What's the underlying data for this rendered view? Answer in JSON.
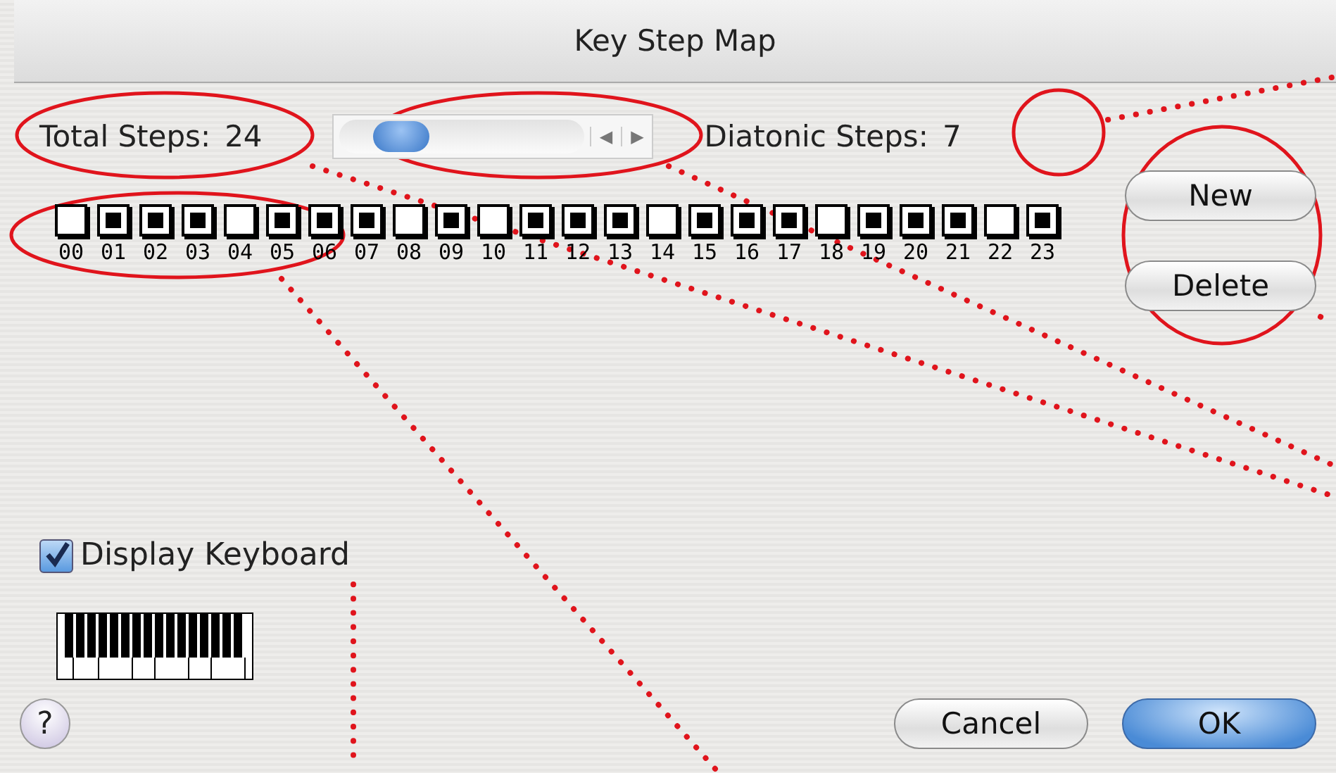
{
  "window": {
    "title": "Key Step Map"
  },
  "total_steps": {
    "label": "Total Steps:",
    "value": "24"
  },
  "diatonic_steps": {
    "label": "Diatonic Steps:",
    "value": "7"
  },
  "steps": [
    {
      "label": "00",
      "checked": false
    },
    {
      "label": "01",
      "checked": true
    },
    {
      "label": "02",
      "checked": true
    },
    {
      "label": "03",
      "checked": true
    },
    {
      "label": "04",
      "checked": false
    },
    {
      "label": "05",
      "checked": true
    },
    {
      "label": "06",
      "checked": true
    },
    {
      "label": "07",
      "checked": true
    },
    {
      "label": "08",
      "checked": false
    },
    {
      "label": "09",
      "checked": true
    },
    {
      "label": "10",
      "checked": false
    },
    {
      "label": "11",
      "checked": true
    },
    {
      "label": "12",
      "checked": true
    },
    {
      "label": "13",
      "checked": true
    },
    {
      "label": "14",
      "checked": false
    },
    {
      "label": "15",
      "checked": true
    },
    {
      "label": "16",
      "checked": true
    },
    {
      "label": "17",
      "checked": true
    },
    {
      "label": "18",
      "checked": false
    },
    {
      "label": "19",
      "checked": true
    },
    {
      "label": "20",
      "checked": true
    },
    {
      "label": "21",
      "checked": true
    },
    {
      "label": "22",
      "checked": false
    },
    {
      "label": "23",
      "checked": true
    }
  ],
  "side_buttons": [
    "New",
    "Delete"
  ],
  "scroll_arrows": [
    "◀",
    "▶"
  ],
  "display_keyboard": {
    "label": "Display Keyboard",
    "checked": true
  },
  "help": "?",
  "buttons": [
    {
      "label": "Cancel",
      "default": false
    },
    {
      "label": "OK",
      "default": true
    }
  ]
}
